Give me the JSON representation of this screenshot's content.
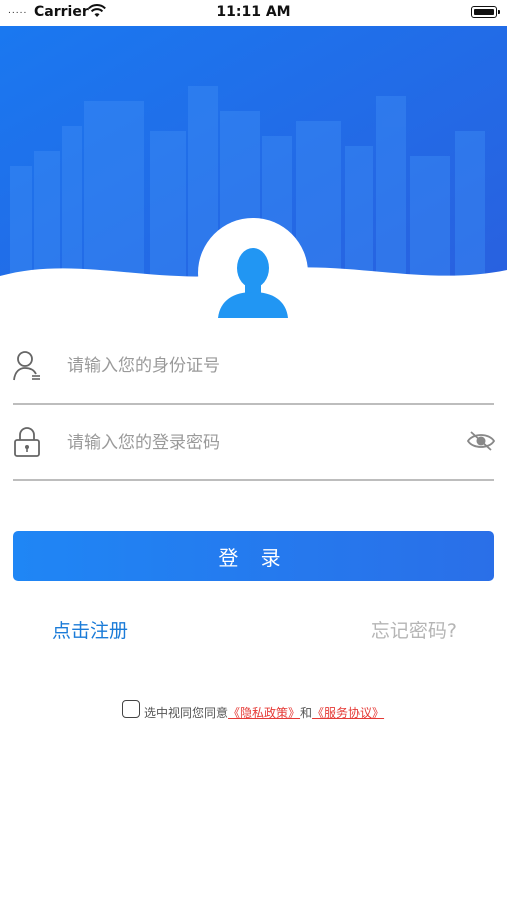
{
  "status_bar": {
    "carrier": "Carrier",
    "time": "11:11 AM",
    "signal": "....."
  },
  "avatar": {
    "icon": "user-avatar-icon"
  },
  "form": {
    "id_number_placeholder": "请输入您的身份证号",
    "password_placeholder": "请输入您的登录密码",
    "id_icon": "user-icon",
    "password_icon": "lock-icon",
    "toggle_visibility_icon": "eye-slash-icon"
  },
  "actions": {
    "login_label": "登 录",
    "register_label": "点击注册",
    "forgot_label": "忘记密码?"
  },
  "agreement": {
    "prefix": "选中视同您同意",
    "privacy": "《隐私政策》",
    "conjunction": "和",
    "service": "《服务协议》"
  },
  "colors": {
    "header_blue": "#1a6fe8",
    "primary_button": "#1f7ff2",
    "link_blue": "#1a7bd8",
    "policy_red": "#e53935"
  }
}
